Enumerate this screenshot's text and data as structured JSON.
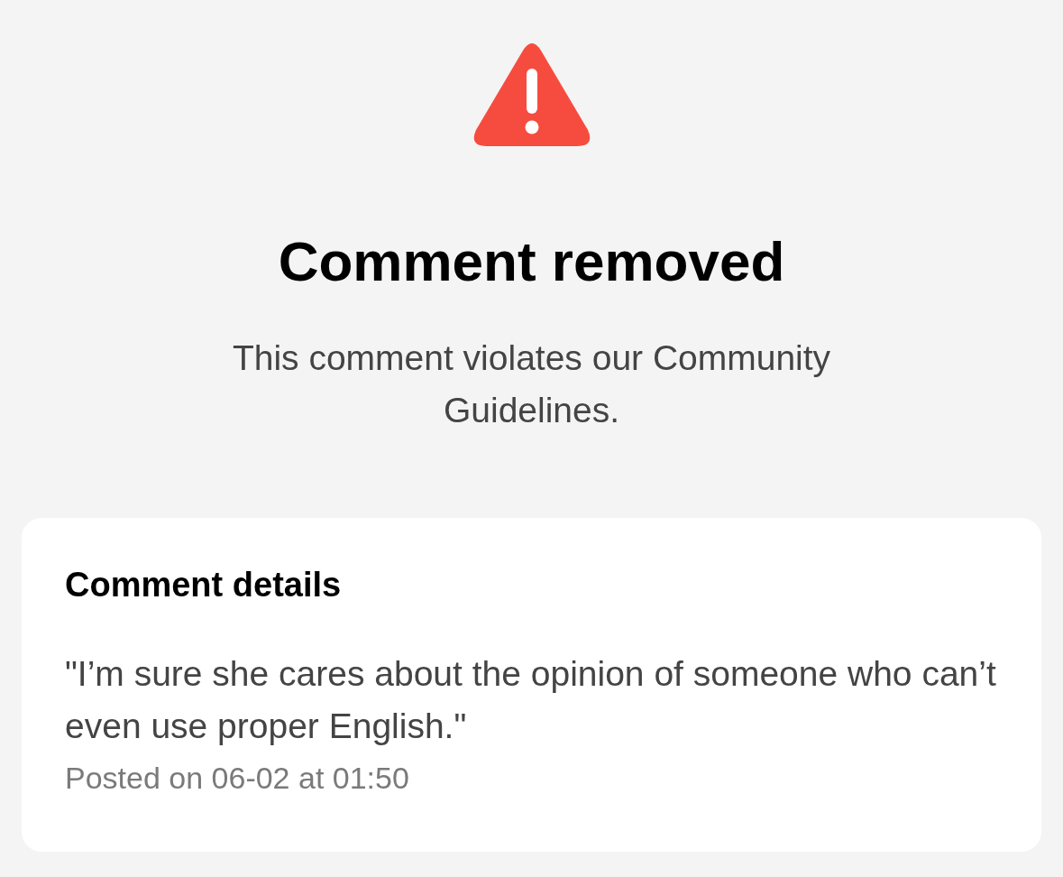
{
  "title": "Comment removed",
  "message": "This comment violates our Community Guidelines.",
  "details": {
    "heading": "Comment details",
    "comment": "\"I’m sure she cares about the opinion of someone who can’t even use proper English.\"",
    "posted": "Posted on 06-02 at 01:50"
  }
}
